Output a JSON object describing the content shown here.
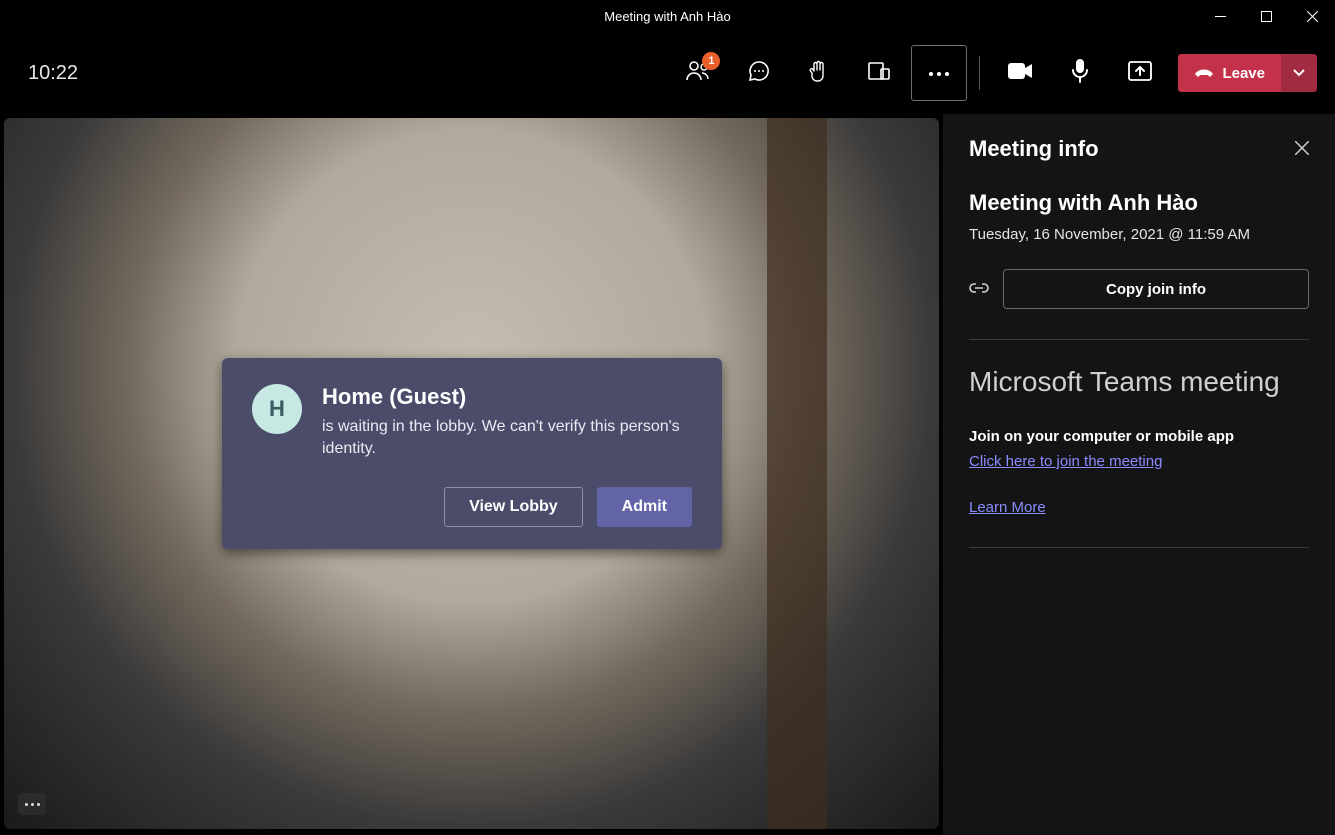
{
  "window": {
    "title": "Meeting with Anh Hào"
  },
  "toolbar": {
    "time": "10:22",
    "participants_badge": "1",
    "leave_label": "Leave"
  },
  "lobby": {
    "avatar_initial": "H",
    "name": "Home (Guest)",
    "message": "is waiting in the lobby. We can't verify this person's identity.",
    "view_lobby_label": "View Lobby",
    "admit_label": "Admit"
  },
  "panel": {
    "heading": "Meeting info",
    "meeting_title": "Meeting with Anh Hào",
    "meeting_date": "Tuesday, 16 November, 2021 @ 11:59 AM",
    "copy_label": "Copy join info",
    "ms_title": "Microsoft Teams meeting",
    "join_on_label": "Join on your computer or mobile app",
    "join_link_label": "Click here to join the meeting",
    "learn_more_label": "Learn More"
  }
}
